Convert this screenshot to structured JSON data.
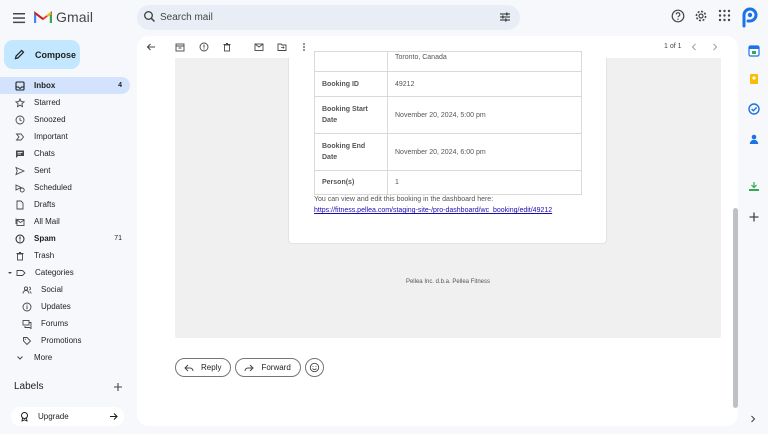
{
  "app": {
    "name": "Gmail"
  },
  "search": {
    "placeholder": "Search mail"
  },
  "compose": {
    "label": "Compose"
  },
  "nav": [
    {
      "icon": "inbox-icon",
      "label": "Inbox",
      "count": "4",
      "active": true
    },
    {
      "icon": "star-icon",
      "label": "Starred"
    },
    {
      "icon": "clock-icon",
      "label": "Snoozed"
    },
    {
      "icon": "important-icon",
      "label": "Important"
    },
    {
      "icon": "chat-icon",
      "label": "Chats"
    },
    {
      "icon": "send-icon",
      "label": "Sent"
    },
    {
      "icon": "scheduled-icon",
      "label": "Scheduled"
    },
    {
      "icon": "draft-icon",
      "label": "Drafts"
    },
    {
      "icon": "all-mail-icon",
      "label": "All Mail"
    },
    {
      "icon": "spam-icon",
      "label": "Spam",
      "count": "71"
    },
    {
      "icon": "trash-icon",
      "label": "Trash"
    },
    {
      "icon": "label-icon",
      "label": "Categories"
    },
    {
      "icon": "social-icon",
      "label": "Social"
    },
    {
      "icon": "updates-icon",
      "label": "Updates"
    },
    {
      "icon": "forums-icon",
      "label": "Forums"
    },
    {
      "icon": "promotions-icon",
      "label": "Promotions"
    },
    {
      "icon": "chevron-down-icon",
      "label": "More"
    }
  ],
  "labels": {
    "heading": "Labels"
  },
  "upgrade": {
    "label": "Upgrade"
  },
  "pager": {
    "text": "1 of 1"
  },
  "email": {
    "partial_row_value": "Toronto, Canada",
    "rows": [
      {
        "key": "Booking ID",
        "value": "49212"
      },
      {
        "key": "Booking Start Date",
        "value": "November 20, 2024, 5:00 pm"
      },
      {
        "key": "Booking End Date",
        "value": "November 20, 2024, 6:00 pm"
      },
      {
        "key": "Person(s)",
        "value": "1"
      }
    ],
    "note": "You can view and edit this booking in the dashboard here:",
    "link": "https://fitness.pellea.com/staging-site-/pro-dashboard/wc_booking/edit/49212",
    "footer": "Pellea Inc. d.b.a. Pellea Fitness"
  },
  "actions": {
    "reply": "Reply",
    "forward": "Forward"
  },
  "colors": {
    "compose_bg": "#c2e7ff",
    "active_nav": "#d3e3fd",
    "page_bg": "#f6f8fc",
    "link": "#1a0dab"
  }
}
